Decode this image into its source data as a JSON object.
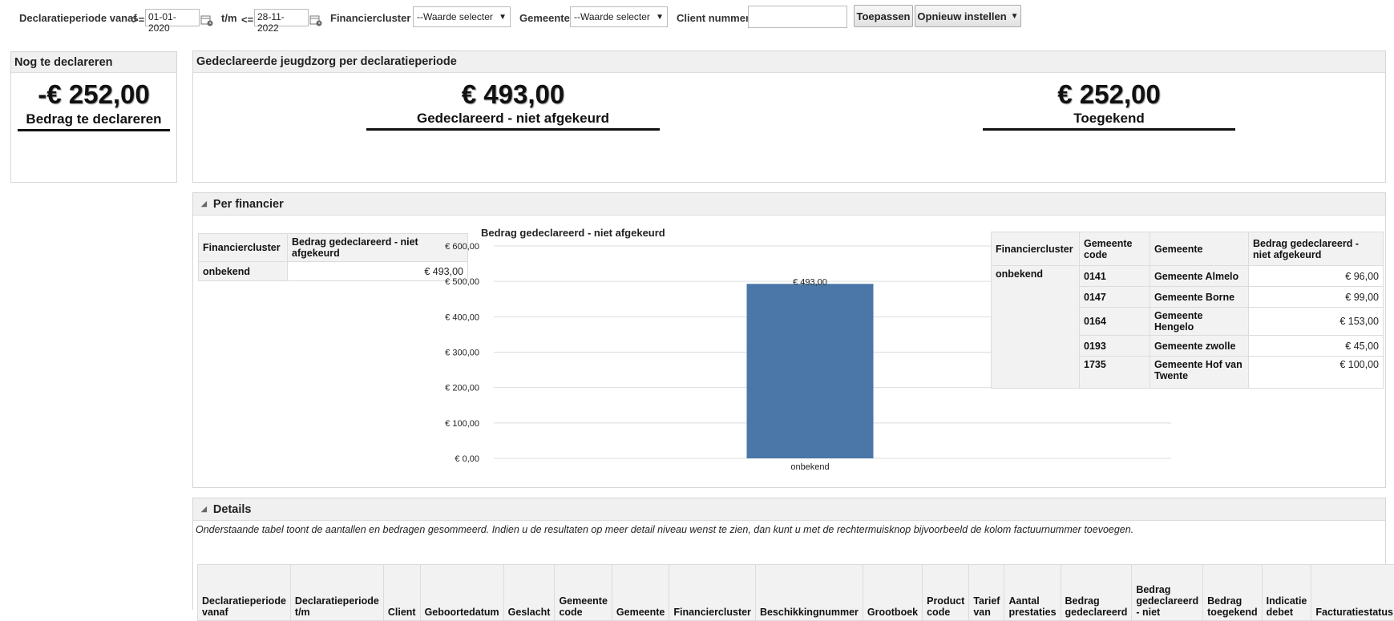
{
  "filters": {
    "period_from_label": "Declaratieperiode vanaf",
    "period_from_op": ">=",
    "period_from_value": "01-01-2020",
    "period_to_label": "t/m",
    "period_to_op": "<=",
    "period_to_value": "28-11-2022",
    "financier_label": "Financiercluster",
    "financier_value": "--Waarde selecter",
    "gemeente_label": "Gemeente",
    "gemeente_value": "--Waarde selecter",
    "client_label": "Client nummer",
    "client_value": "",
    "apply_button": "Toepassen",
    "reset_button": "Opnieuw instellen"
  },
  "nog_panel": {
    "title": "Nog te declareren",
    "value": "-€ 252,00",
    "label": "Bedrag te declareren"
  },
  "jeugdzorg_panel": {
    "title": "Gedeclareerde jeugdzorg per declaratieperiode",
    "kpi1_value": "€ 493,00",
    "kpi1_label": "Gedeclareerd - niet afgekeurd",
    "kpi2_value": "€ 252,00",
    "kpi2_label": "Toegekend"
  },
  "per_financier": {
    "title": "Per financier",
    "left_table": {
      "headers": [
        "Financiercluster",
        "Bedrag gedeclareerd - niet afgekeurd"
      ],
      "rows": [
        [
          "onbekend",
          "€ 493,00"
        ]
      ]
    },
    "right_table": {
      "headers": [
        "Financiercluster",
        "Gemeente code",
        "Gemeente",
        "Bedrag gedeclareerd - niet afgekeurd"
      ],
      "group": "onbekend",
      "rows": [
        [
          "0141",
          "Gemeente Almelo",
          "€ 96,00"
        ],
        [
          "0147",
          "Gemeente Borne",
          "€ 99,00"
        ],
        [
          "0164",
          "Gemeente Hengelo",
          "€ 153,00"
        ],
        [
          "0193",
          "Gemeente zwolle",
          "€ 45,00"
        ],
        [
          "1735",
          "Gemeente Hof van Twente",
          "€ 100,00"
        ]
      ]
    }
  },
  "chart_data": {
    "type": "bar",
    "title": "Bedrag gedeclareerd - niet afgekeurd",
    "categories": [
      "onbekend"
    ],
    "values": [
      493
    ],
    "data_labels": [
      "€ 493,00"
    ],
    "ylim": [
      0,
      600
    ],
    "yticks": [
      0,
      100,
      200,
      300,
      400,
      500,
      600
    ],
    "ytick_labels": [
      "€ 0,00",
      "€ 100,00",
      "€ 200,00",
      "€ 300,00",
      "€ 400,00",
      "€ 500,00",
      "€ 600,00"
    ],
    "grid": true,
    "color": "#4a77a8"
  },
  "details": {
    "title": "Details",
    "description": "Onderstaande tabel toont de aantallen en bedragen gesommeerd. Indien u de resultaten op meer detail niveau wenst te zien, dan kunt u met de rechtermuisknop bijvoorbeeld de kolom factuurnummer toevoegen.",
    "headers": [
      "Declaratieperiode vanaf",
      "Declaratieperiode t/m",
      "Client",
      "Geboortedatum",
      "Geslacht",
      "Gemeente code",
      "Gemeente",
      "Financiercluster",
      "Beschikkingnummer",
      "Grootboek",
      "Product code",
      "Tarief van",
      "Aantal prestaties",
      "Bedrag gedeclareerd",
      "Bedrag gedeclareerd - niet",
      "Bedrag toegekend",
      "Indicatie debet",
      "Facturatiestatus"
    ]
  }
}
